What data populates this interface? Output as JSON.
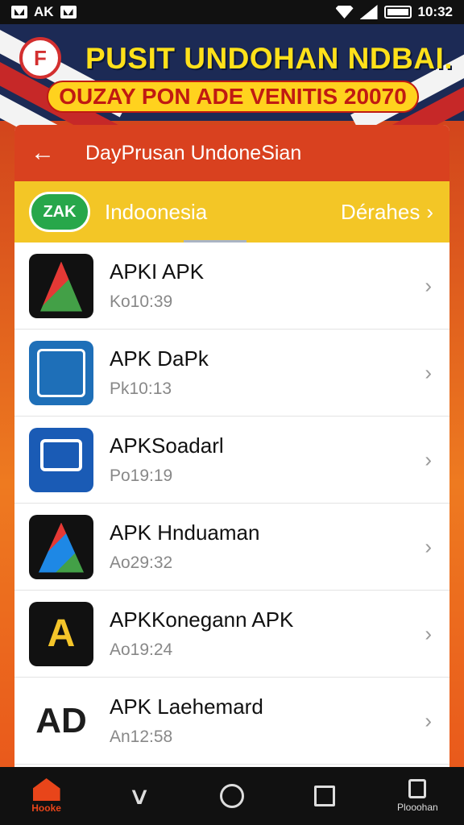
{
  "status": {
    "left_text": "AK",
    "time": "10:32"
  },
  "banner": {
    "logo_glyph": "F",
    "title": "PUSIT UNDOHAN NDBAI.",
    "subtitle": "OUZAY PON ADE VENITIS 20070"
  },
  "appbar": {
    "back_glyph": "←",
    "title": "DayPrusan UndoneSian"
  },
  "country": {
    "badge": "ZAK",
    "name": "Indoonesia",
    "action": "Dérahes",
    "action_chevron": "›"
  },
  "apps": [
    {
      "name": "APKI APK",
      "time": "Ko10:39",
      "icon": "apk-a-icon",
      "glyph": ""
    },
    {
      "name": "APK DaPk",
      "time": "Pk10:13",
      "icon": "apk-box-icon",
      "glyph": ""
    },
    {
      "name": "APKSoadarl",
      "time": "Po19:19",
      "icon": "apk-gear-icon",
      "glyph": ""
    },
    {
      "name": "APK Hnduaman",
      "time": "Ao29:32",
      "icon": "apk-triangle-icon",
      "glyph": ""
    },
    {
      "name": "APKKonegann APK",
      "time": "Ao19:24",
      "icon": "apk-letter-a-icon",
      "glyph": "A"
    },
    {
      "name": "APK Laehemard",
      "time": "An12:58",
      "icon": "apk-ad-icon",
      "glyph": "AD"
    }
  ],
  "row_chevron": "›",
  "nav": {
    "home_label": "Hooke",
    "last_label": "Plooohan"
  },
  "colors": {
    "appbar": "#d9411f",
    "country_bar": "#f3c626",
    "accent": "#e8451a"
  }
}
